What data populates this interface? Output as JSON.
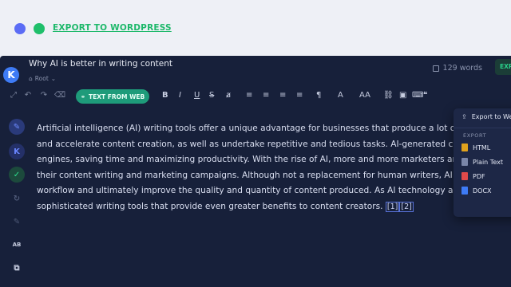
{
  "promo": {
    "link_label": "EXPORT TO WORDPRESS"
  },
  "status": {
    "word_count": "129 words",
    "export_label": "EXPORT"
  },
  "header": {
    "title": "Why AI is better in writing content",
    "breadcrumb": "Root",
    "logo_letter": "K"
  },
  "toolbar": {
    "text_from_web": "TEXT FROM WEB"
  },
  "menu": {
    "export_to": "Export to Web",
    "section_label": "EXPORT",
    "items": [
      "HTML",
      "Plain Text",
      "PDF",
      "DOCX"
    ]
  },
  "content": {
    "lines": [
      "Artificial intelligence (AI) writing tools offer a unique advantage for businesses that produce a lot of content. The s",
      "and accelerate content creation, as well as undertake repetitive and tedious tasks. AI-generated content can also l",
      "engines, saving time and maximizing productivity. With the rise of AI, more and more marketers are turning to AI w",
      "their content writing and marketing campaigns. Although not a replacement for human writers, AI writing tools ca",
      "workflow and ultimately improve the quality and quantity of content produced. As AI technology advances, we ca",
      "sophisticated writing tools that provide even greater benefits to content creators."
    ],
    "citations": [
      "[1]",
      "[2]"
    ]
  },
  "colors": {
    "accent": "#1db86a",
    "brand": "#3e7bf5",
    "bg": "#17203a"
  }
}
